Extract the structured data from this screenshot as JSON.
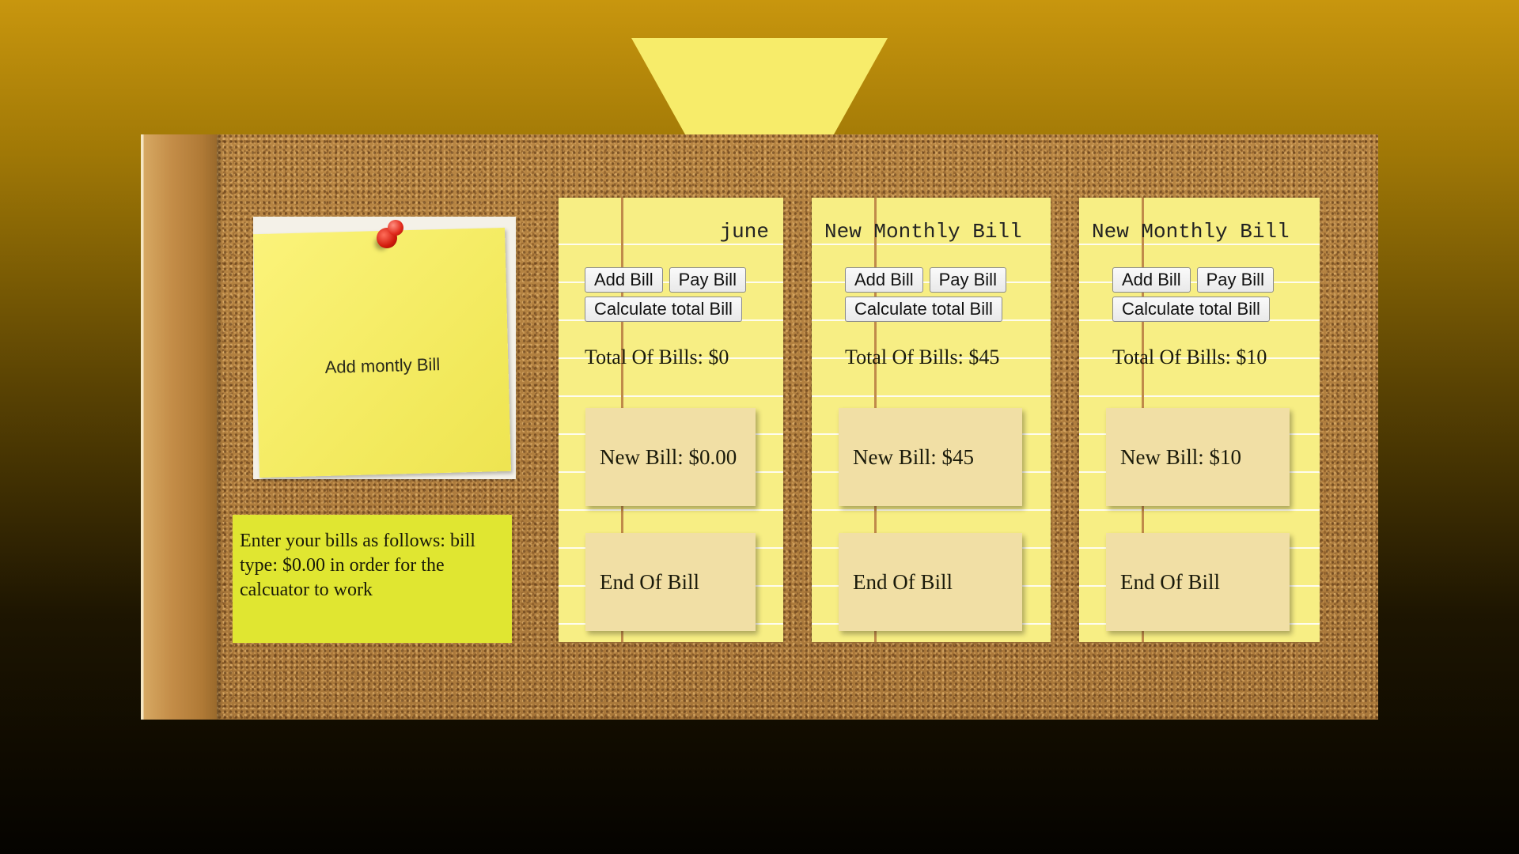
{
  "add_note": {
    "label": "Add montly Bill"
  },
  "instructions": {
    "text": "Enter your bills as follows: bill type: $0.00 in order for the calcuator to work"
  },
  "cards": [
    {
      "title": "june",
      "add_label": "Add Bill",
      "pay_label": "Pay Bill",
      "calc_label": "Calculate total Bill",
      "total": "Total Of Bills: $0",
      "new_bill": "New Bill: $0.00",
      "end_bill": "End Of Bill"
    },
    {
      "title": "New Monthly Bill",
      "add_label": "Add Bill",
      "pay_label": "Pay Bill",
      "calc_label": "Calculate total Bill",
      "total": "Total Of Bills: $45",
      "new_bill": "New Bill: $45",
      "end_bill": "End Of Bill"
    },
    {
      "title": "New Monthly Bill",
      "add_label": "Add Bill",
      "pay_label": "Pay Bill",
      "calc_label": "Calculate total Bill",
      "total": "Total Of Bills: $10",
      "new_bill": "New Bill: $10",
      "end_bill": "End Of Bill"
    }
  ],
  "colors": {
    "note_yellow": "#f7ee84",
    "instructions_bg": "#e0e631",
    "tile_bg": "#f1dfa5",
    "pin_red": "#d11a0c",
    "lamp_yellow": "#f7ec6a"
  },
  "icons": {
    "pin": "push-pin-icon"
  }
}
